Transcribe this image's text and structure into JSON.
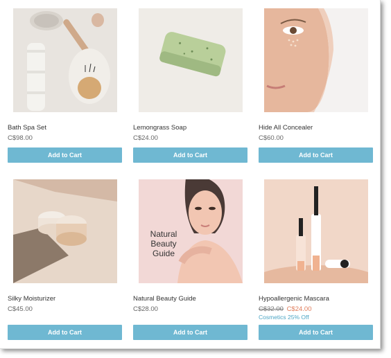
{
  "products": [
    {
      "name": "Bath Spa Set",
      "price": "C$98.00",
      "button": "Add to Cart"
    },
    {
      "name": "Lemongrass Soap",
      "price": "C$24.00",
      "button": "Add to Cart"
    },
    {
      "name": "Hide All Concealer",
      "price": "C$60.00",
      "button": "Add to Cart"
    },
    {
      "name": "Silky Moisturizer",
      "price": "C$45.00",
      "button": "Add to Cart"
    },
    {
      "name": "Natural Beauty Guide",
      "price": "C$28.00",
      "button": "Add to Cart",
      "image_text": "Natural Beauty Guide"
    },
    {
      "name": "Hypoallergenic Mascara",
      "original_price": "C$32.00",
      "sale_price": "C$24.00",
      "promo": "Cosmetics 25% Off",
      "button": "Add to Cart"
    }
  ],
  "colors": {
    "button": "#6fb8d2",
    "sale": "#e07c5a",
    "promo": "#4da6c5"
  }
}
